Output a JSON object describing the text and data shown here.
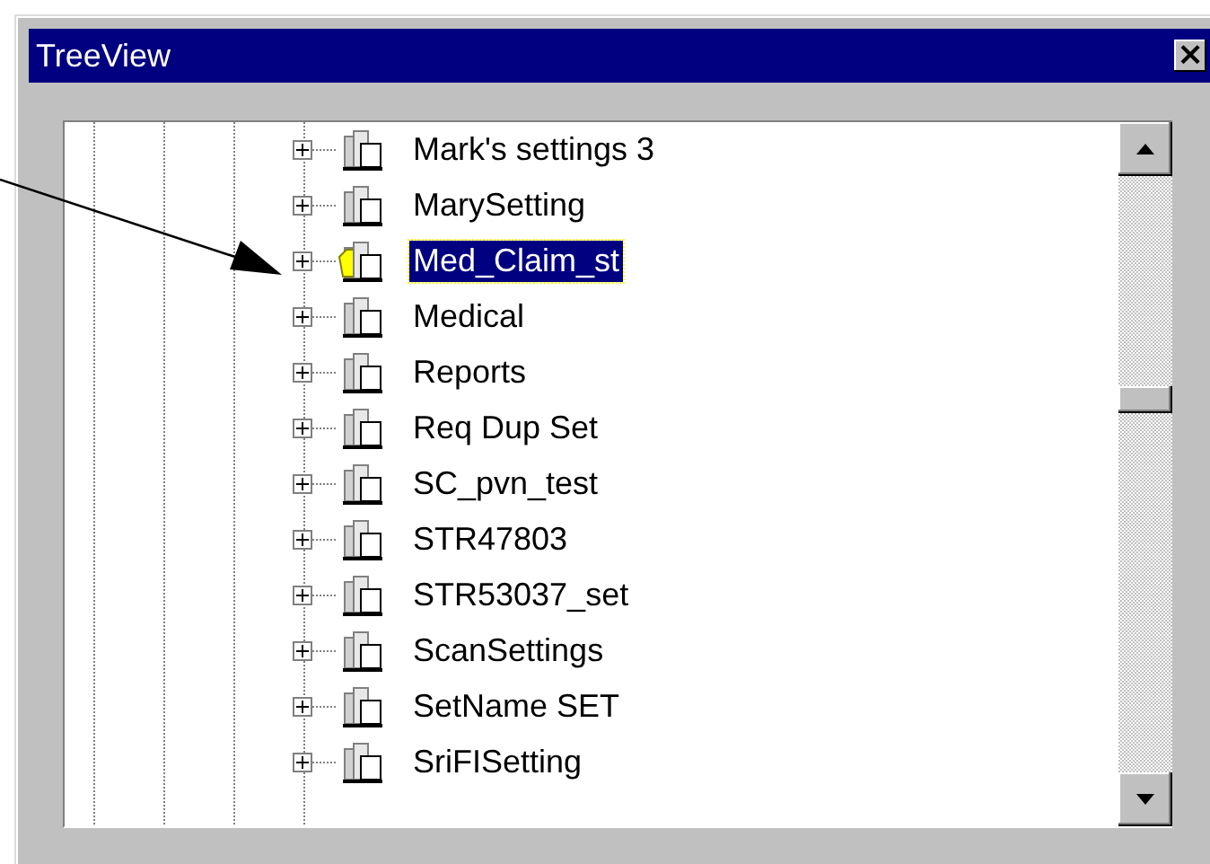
{
  "window": {
    "title": "TreeView",
    "close_glyph": "×"
  },
  "tree": {
    "items": [
      {
        "label": "Mark's settings 3",
        "selected": false
      },
      {
        "label": "MarySetting",
        "selected": false
      },
      {
        "label": "Med_Claim_st",
        "selected": true
      },
      {
        "label": "Medical",
        "selected": false
      },
      {
        "label": "Reports",
        "selected": false
      },
      {
        "label": "Req Dup Set",
        "selected": false
      },
      {
        "label": "SC_pvn_test",
        "selected": false
      },
      {
        "label": "STR47803",
        "selected": false
      },
      {
        "label": "STR53037_set",
        "selected": false
      },
      {
        "label": "ScanSettings",
        "selected": false
      },
      {
        "label": "SetName SET",
        "selected": false
      },
      {
        "label": "SriFISetting",
        "selected": false
      }
    ]
  }
}
